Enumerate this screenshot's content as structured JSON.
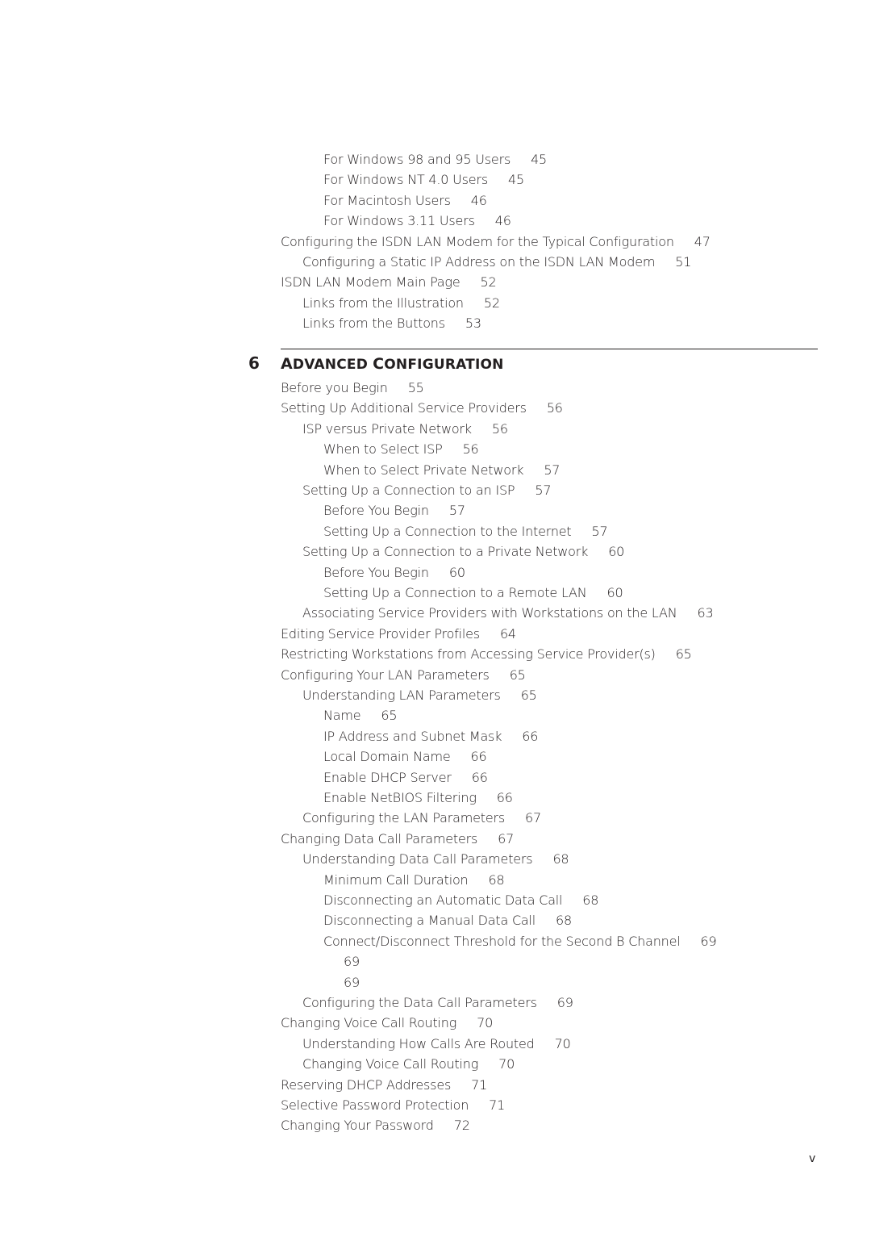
{
  "pre_entries": [
    {
      "level": 2,
      "title": "For Windows 98 and 95 Users",
      "page": "45"
    },
    {
      "level": 2,
      "title": "For Windows NT 4.0 Users",
      "page": "45"
    },
    {
      "level": 2,
      "title": "For Macintosh Users",
      "page": "46"
    },
    {
      "level": 2,
      "title": "For Windows 3.11 Users",
      "page": "46"
    },
    {
      "level": 0,
      "title": "Configuring the ISDN LAN Modem for the Typical Configuration",
      "page": "47"
    },
    {
      "level": 1,
      "title": "Configuring a Static IP Address on the ISDN LAN Modem",
      "page": "51"
    },
    {
      "level": 0,
      "title": "ISDN LAN Modem Main Page",
      "page": "52"
    },
    {
      "level": 1,
      "title": "Links from the Illustration",
      "page": "52"
    },
    {
      "level": 1,
      "title": "Links from the Buttons",
      "page": "53"
    }
  ],
  "chapter": {
    "number": "6",
    "title_parts": [
      {
        "cap": "A",
        "rest": "DVANCED "
      },
      {
        "cap": "C",
        "rest": "ONFIGURATION"
      }
    ]
  },
  "entries": [
    {
      "level": 0,
      "title": "Before you Begin",
      "page": "55"
    },
    {
      "level": 0,
      "title": "Setting Up Additional Service Providers",
      "page": "56"
    },
    {
      "level": 1,
      "title": "ISP versus Private Network",
      "page": "56"
    },
    {
      "level": 2,
      "title": "When to Select ISP",
      "page": "56"
    },
    {
      "level": 2,
      "title": "When to Select Private Network",
      "page": "57"
    },
    {
      "level": 1,
      "title": "Setting Up a Connection to an ISP",
      "page": "57"
    },
    {
      "level": 2,
      "title": "Before You Begin",
      "page": "57"
    },
    {
      "level": 2,
      "title": "Setting Up a Connection to the Internet",
      "page": "57"
    },
    {
      "level": 1,
      "title": "Setting Up a Connection to a Private Network",
      "page": "60"
    },
    {
      "level": 2,
      "title": "Before You Begin",
      "page": "60"
    },
    {
      "level": 2,
      "title": "Setting Up a Connection to a Remote LAN",
      "page": "60"
    },
    {
      "level": 1,
      "title": "Associating Service Providers with Workstations on the LAN",
      "page": "63"
    },
    {
      "level": 0,
      "title": "Editing Service Provider Profiles",
      "page": "64"
    },
    {
      "level": 0,
      "title": "Restricting Workstations from Accessing Service Provider(s)",
      "page": "65"
    },
    {
      "level": 0,
      "title": "Configuring Your LAN Parameters",
      "page": "65"
    },
    {
      "level": 1,
      "title": "Understanding LAN Parameters",
      "page": "65"
    },
    {
      "level": 2,
      "title": "Name",
      "page": "65"
    },
    {
      "level": 2,
      "title": "IP Address and Subnet Mask",
      "page": "66"
    },
    {
      "level": 2,
      "title": "Local Domain Name",
      "page": "66"
    },
    {
      "level": 2,
      "title": "Enable DHCP Server",
      "page": "66"
    },
    {
      "level": 2,
      "title": "Enable NetBIOS Filtering",
      "page": "66"
    },
    {
      "level": 1,
      "title": "Configuring the LAN Parameters",
      "page": "67"
    },
    {
      "level": 0,
      "title": "Changing Data Call Parameters",
      "page": "67"
    },
    {
      "level": 1,
      "title": "Understanding Data Call Parameters",
      "page": "68"
    },
    {
      "level": 2,
      "title": "Minimum Call Duration",
      "page": "68"
    },
    {
      "level": 2,
      "title": "Disconnecting an Automatic Data Call",
      "page": "68"
    },
    {
      "level": 2,
      "title": "Disconnecting a Manual Data Call",
      "page": "68"
    },
    {
      "level": 2,
      "title": "Connect/Disconnect Threshold for the Second B Channel",
      "page": "69"
    },
    {
      "level": 3,
      "title": "",
      "page": "69"
    },
    {
      "level": 3,
      "title": "",
      "page": "69"
    },
    {
      "level": 1,
      "title": "Configuring the Data Call Parameters",
      "page": "69"
    },
    {
      "level": 0,
      "title": "Changing Voice Call Routing",
      "page": "70"
    },
    {
      "level": 1,
      "title": "Understanding How Calls Are Routed",
      "page": "70"
    },
    {
      "level": 1,
      "title": "Changing Voice Call Routing",
      "page": "70"
    },
    {
      "level": 0,
      "title": "Reserving DHCP Addresses",
      "page": "71"
    },
    {
      "level": 0,
      "title": "Selective Password Protection",
      "page": "71"
    },
    {
      "level": 0,
      "title": "Changing Your Password",
      "page": "72"
    }
  ],
  "folio": "v"
}
